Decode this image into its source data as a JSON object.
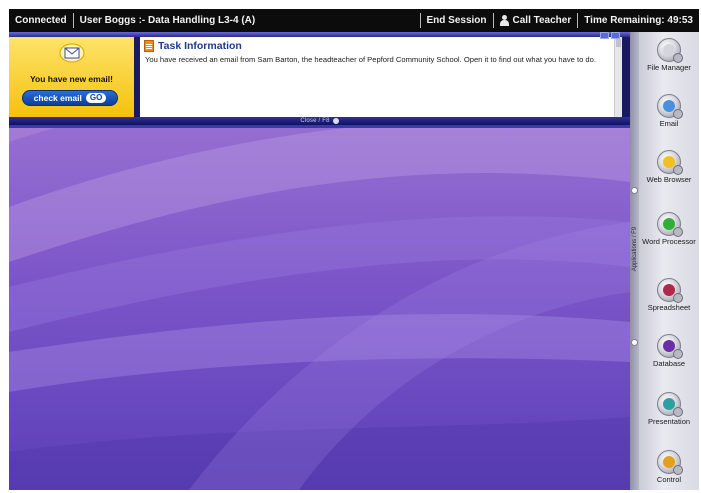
{
  "topbar": {
    "status": "Connected",
    "user_session": "User Boggs :- Data Handling L3-4 (A)",
    "end_session": "End Session",
    "call_teacher": "Call Teacher",
    "time_remaining": "Time Remaining: 49:53"
  },
  "email_notice": {
    "message": "You have new email!",
    "button_label": "check email",
    "go_label": "GO",
    "icon": "envelope-icon"
  },
  "task": {
    "title": "Task Information",
    "text": "You have received an email from Sam Barton, the headteacher of Pepford Community School. Open it to find out what you have to do.",
    "close_label": "Close / F8"
  },
  "applications": {
    "handle_label": "Applications / F9",
    "items": [
      {
        "label": "File Manager",
        "icon": "file-manager-icon",
        "color": "#c8c8d0"
      },
      {
        "label": "Email",
        "icon": "email-icon",
        "color": "#4a8fe0"
      },
      {
        "label": "Web Browser",
        "icon": "web-browser-icon",
        "color": "#f0c020"
      },
      {
        "label": "Word Processor",
        "icon": "word-processor-icon",
        "color": "#2fae3a"
      },
      {
        "label": "Spreadsheet",
        "icon": "spreadsheet-icon",
        "color": "#b0284a"
      },
      {
        "label": "Database",
        "icon": "database-icon",
        "color": "#6a2fa8"
      },
      {
        "label": "Presentation",
        "icon": "presentation-icon",
        "color": "#2aa0a0"
      },
      {
        "label": "Control",
        "icon": "control-icon",
        "color": "#e0a020"
      }
    ]
  }
}
